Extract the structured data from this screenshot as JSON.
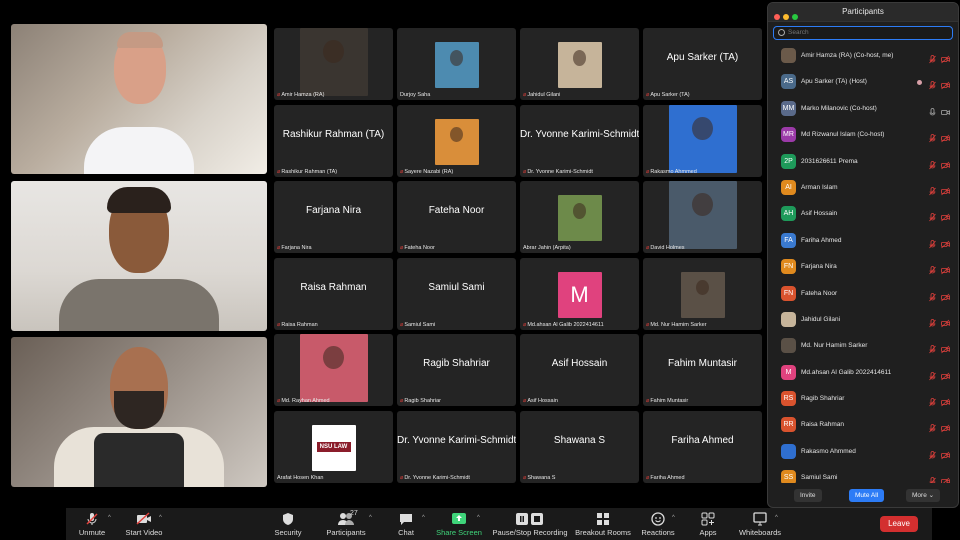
{
  "pinned": [
    {
      "label": ""
    },
    {
      "label": ""
    },
    {
      "label": ""
    }
  ],
  "tiles": [
    {
      "name": "",
      "label": "Amir Hamza (RA)",
      "muted": true,
      "thumb": "#3a3530"
    },
    {
      "name": "",
      "label": "Durjoy Saha",
      "muted": false,
      "thumb": "#4d8bb0"
    },
    {
      "name": "",
      "label": "Jahidul Gilani",
      "muted": true,
      "thumb": "#c6b49a"
    },
    {
      "name": "Apu Sarker (TA)",
      "label": "Apu Sarker (TA)",
      "muted": true,
      "thumb": ""
    },
    {
      "name": "Rashikur Rahman (TA)",
      "label": "Rashikur Rahman (TA)",
      "muted": true,
      "thumb": ""
    },
    {
      "name": "",
      "label": "Sayere Nazabi (RA)",
      "muted": true,
      "thumb": "#d98e3a"
    },
    {
      "name": "Dr. Yvonne Karimi-Schmidt",
      "label": "Dr. Yvonne Karimi-Schmidt",
      "muted": true,
      "thumb": ""
    },
    {
      "name": "",
      "label": "Rakasmo Ahmmed",
      "muted": true,
      "thumb": "#2f6fd0"
    },
    {
      "name": "Farjana Nira",
      "label": "Farjana Nira",
      "muted": true,
      "thumb": ""
    },
    {
      "name": "Fateha Noor",
      "label": "Fateha Noor",
      "muted": true,
      "thumb": ""
    },
    {
      "name": "",
      "label": "Abrar Jahin (Arpita)",
      "muted": false,
      "thumb": "#6d8a4a"
    },
    {
      "name": "",
      "label": "David Holmes",
      "muted": true,
      "thumb": "#4a5a6a"
    },
    {
      "name": "Raisa Rahman",
      "label": "Raisa Rahman",
      "muted": true,
      "thumb": ""
    },
    {
      "name": "Samiul Sami",
      "label": "Samiul Sami",
      "muted": true,
      "thumb": ""
    },
    {
      "name": "",
      "label": "Md.ahsan Al Galib 2022414611",
      "muted": true,
      "thumb": "#e0427e",
      "letter": "M"
    },
    {
      "name": "",
      "label": "Md. Nur Hamim Sarker",
      "muted": true,
      "thumb": "#5a5046"
    },
    {
      "name": "",
      "label": "Md. Rayhan Ahmed",
      "muted": true,
      "thumb": "#c85a6a"
    },
    {
      "name": "Ragib Shahriar",
      "label": "Ragib Shahriar",
      "muted": true,
      "thumb": ""
    },
    {
      "name": "Asif Hossain",
      "label": "Asif Hossain",
      "muted": true,
      "thumb": ""
    },
    {
      "name": "Fahim Muntasir",
      "label": "Fahim Muntasir",
      "muted": true,
      "thumb": ""
    },
    {
      "name": "",
      "label": "Arafat Hosen Khan",
      "muted": false,
      "thumb": "#ffffff",
      "logo": "NSU LAW"
    },
    {
      "name": "Dr. Yvonne Karimi-Schmidt",
      "label": "Dr. Yvonne Karimi-Schmidt",
      "muted": true,
      "thumb": ""
    },
    {
      "name": "Shawana S",
      "label": "Shawana S",
      "muted": true,
      "thumb": ""
    },
    {
      "name": "Fariha Ahmed",
      "label": "Fariha Ahmed",
      "muted": true,
      "thumb": ""
    }
  ],
  "participants": {
    "title": "Participants",
    "search_placeholder": "Search",
    "list": [
      {
        "name": "Amir Hamza (RA) (Co-host, me)",
        "initials": "",
        "color": "#6b5a4a",
        "mic": "muted",
        "cam": "off"
      },
      {
        "name": "Apu Sarker (TA) (Host)",
        "initials": "AS",
        "color": "#4a6a8a",
        "mic": "muted",
        "cam": "off",
        "hand": true
      },
      {
        "name": "Marko Milanovic (Co-host)",
        "initials": "MM",
        "color": "#5a6a8a",
        "mic": "on",
        "cam": "on"
      },
      {
        "name": "Md Rizwanul Islam (Co-host)",
        "initials": "MR",
        "color": "#9b3aa8",
        "mic": "muted",
        "cam": "off"
      },
      {
        "name": "2031626611 Prema",
        "initials": "2P",
        "color": "#1e9a5a",
        "mic": "muted",
        "cam": "off"
      },
      {
        "name": "Arman Islam",
        "initials": "AI",
        "color": "#e08a1e",
        "mic": "muted",
        "cam": "off"
      },
      {
        "name": "Asif Hossain",
        "initials": "AH",
        "color": "#1e9a5a",
        "mic": "muted",
        "cam": "off"
      },
      {
        "name": "Fariha Ahmed",
        "initials": "FA",
        "color": "#3a7ad0",
        "mic": "muted",
        "cam": "off"
      },
      {
        "name": "Farjana Nira",
        "initials": "FN",
        "color": "#e08a1e",
        "mic": "muted",
        "cam": "off"
      },
      {
        "name": "Fateha Noor",
        "initials": "FN",
        "color": "#d9532e",
        "mic": "muted",
        "cam": "off"
      },
      {
        "name": "Jahidul Gilani",
        "initials": "",
        "color": "#c6b49a",
        "mic": "muted",
        "cam": "off"
      },
      {
        "name": "Md. Nur Hamim Sarker",
        "initials": "",
        "color": "#5a5046",
        "mic": "muted",
        "cam": "off"
      },
      {
        "name": "Md.ahsan Al Galib 2022414611",
        "initials": "M",
        "color": "#e0427e",
        "mic": "muted",
        "cam": "off"
      },
      {
        "name": "Ragib Shahriar",
        "initials": "RS",
        "color": "#d9532e",
        "mic": "muted",
        "cam": "off"
      },
      {
        "name": "Raisa Rahman",
        "initials": "RR",
        "color": "#d9532e",
        "mic": "muted",
        "cam": "off"
      },
      {
        "name": "Rakasmo Ahmmed",
        "initials": "",
        "color": "#2f6fd0",
        "mic": "muted",
        "cam": "off"
      },
      {
        "name": "Samiul Sami",
        "initials": "SS",
        "color": "#e08a1e",
        "mic": "muted",
        "cam": "off"
      }
    ],
    "invite_label": "Invite",
    "mute_all_label": "Mute All",
    "more_label": "More"
  },
  "toolbar": {
    "unmute": "Unmute",
    "start_video": "Start Video",
    "security": "Security",
    "participants": "Participants",
    "participants_count": "27",
    "chat": "Chat",
    "share_screen": "Share Screen",
    "recording": "Pause/Stop Recording",
    "breakout": "Breakout Rooms",
    "reactions": "Reactions",
    "apps": "Apps",
    "whiteboards": "Whiteboards",
    "leave": "Leave"
  },
  "colors": {
    "accent": "#2d7cf6",
    "muted_red": "#e0403c",
    "share_green": "#3fd47a",
    "leave_red": "#d32f2f"
  }
}
